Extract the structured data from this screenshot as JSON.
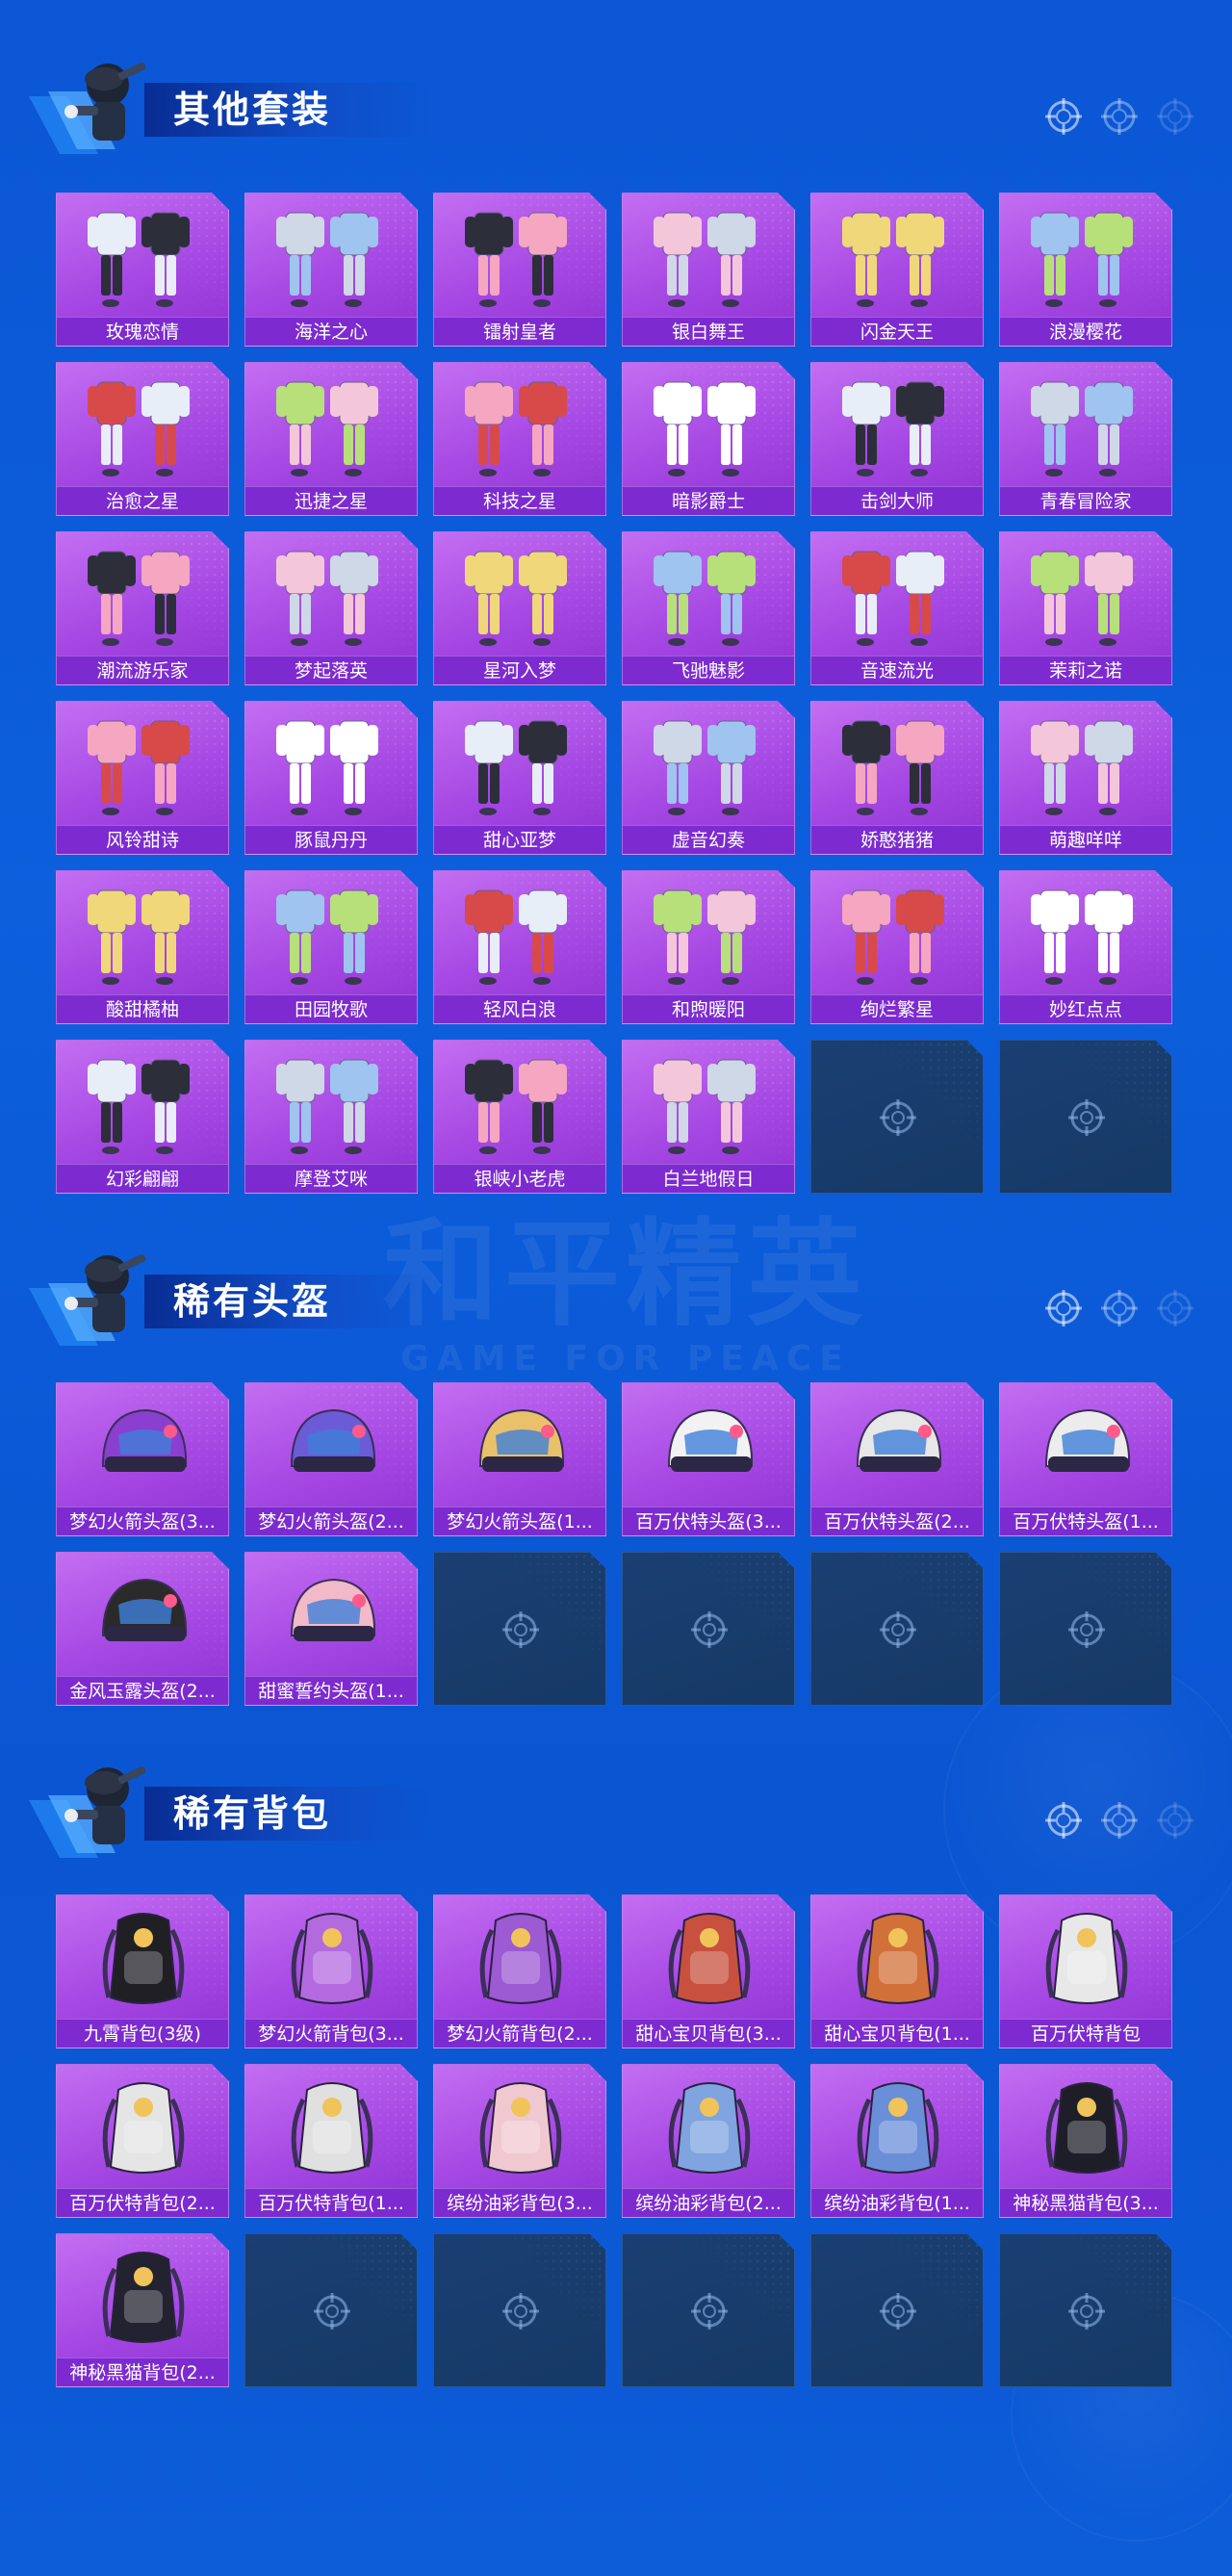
{
  "colors": {
    "background": "#0b56d4",
    "card_purple": "#a547e3",
    "card_label_bar": "#7d2bd0",
    "empty_slot": "#1a3f72"
  },
  "watermark": {
    "cn": "和平精英",
    "en": "GAME FOR PEACE"
  },
  "sections": [
    {
      "id": "outfits",
      "title": "其他套装",
      "icon": "outfit-icon",
      "items": [
        "玫瑰恋情",
        "海洋之心",
        "镭射皇者",
        "银白舞王",
        "闪金天王",
        "浪漫樱花",
        "治愈之星",
        "迅捷之星",
        "科技之星",
        "暗影爵士",
        "击剑大师",
        "青春冒险家",
        "潮流游乐家",
        "梦起落英",
        "星河入梦",
        "飞驰魅影",
        "音速流光",
        "茉莉之诺",
        "风铃甜诗",
        "豚鼠丹丹",
        "甜心亚梦",
        "虚音幻奏",
        "娇憨猪猪",
        "萌趣咩咩",
        "酸甜橘柚",
        "田园牧歌",
        "轻风白浪",
        "和煦暖阳",
        "绚烂繁星",
        "妙红点点",
        "幻彩翩翩",
        "摩登艾咪",
        "银峡小老虎",
        "白兰地假日"
      ],
      "empty_slots": 2
    },
    {
      "id": "helmets",
      "title": "稀有头盔",
      "icon": "helmet-icon",
      "items": [
        "梦幻火箭头盔(3...",
        "梦幻火箭头盔(2...",
        "梦幻火箭头盔(1...",
        "百万伏特头盔(3...",
        "百万伏特头盔(2...",
        "百万伏特头盔(1...",
        "金风玉露头盔(2...",
        "甜蜜誓约头盔(1..."
      ],
      "empty_slots": 4
    },
    {
      "id": "backpacks",
      "title": "稀有背包",
      "icon": "backpack-icon",
      "items": [
        "九霄背包(3级)",
        "梦幻火箭背包(3...",
        "梦幻火箭背包(2...",
        "甜心宝贝背包(3...",
        "甜心宝贝背包(1...",
        "百万伏特背包",
        "百万伏特背包(2...",
        "百万伏特背包(1...",
        "缤纷油彩背包(3...",
        "缤纷油彩背包(2...",
        "缤纷油彩背包(1...",
        "神秘黑猫背包(3...",
        "神秘黑猫背包(2..."
      ],
      "empty_slots": 5
    }
  ]
}
